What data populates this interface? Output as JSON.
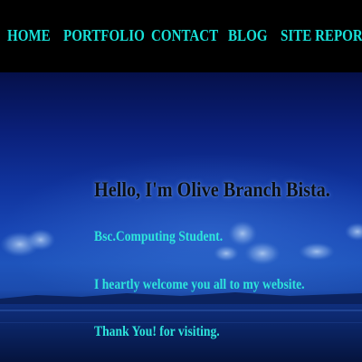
{
  "nav": {
    "items": [
      {
        "label": "HOME"
      },
      {
        "label": "PORTFOLIO"
      },
      {
        "label": "CONTACT"
      },
      {
        "label": "BLOG"
      },
      {
        "label": "SITE REPORT"
      }
    ]
  },
  "hero": {
    "greeting": "Hello, I'm Olive Branch Bista.",
    "subtitle": "Bsc.Computing Student.",
    "welcome": "I heartly welcome you all to my website.",
    "thanks": "Thank You! for visiting."
  },
  "colors": {
    "nav_background": "#000000",
    "nav_text": "#18e0d8",
    "hero_text": "#2ee6dc",
    "greeting_text": "#0a0f14",
    "sky_top": "#05104a",
    "sky_mid": "#1846b4",
    "water": "#061a4c"
  }
}
